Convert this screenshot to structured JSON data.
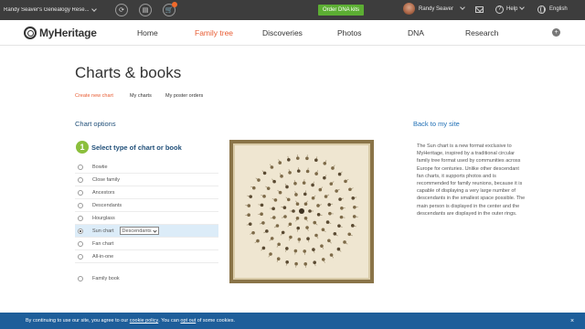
{
  "topbar": {
    "site_name": "Randy Seaver's Genealogy Rese...",
    "order_dna": "Order DNA kits",
    "user_name": "Randy Seaver",
    "help": "Help",
    "language": "English"
  },
  "nav": {
    "logo": "MyHeritage",
    "items": [
      {
        "label": "Home"
      },
      {
        "label": "Family tree"
      },
      {
        "label": "Discoveries"
      },
      {
        "label": "Photos"
      },
      {
        "label": "DNA"
      },
      {
        "label": "Research"
      }
    ],
    "active": "Family tree"
  },
  "page": {
    "title": "Charts & books",
    "subtabs": [
      {
        "label": "Create new chart"
      },
      {
        "label": "My charts"
      },
      {
        "label": "My poster orders"
      }
    ],
    "section_label": "Chart options",
    "back_link": "Back to my site",
    "step_number": "1",
    "step_title": "Select type of chart or book",
    "options": [
      {
        "label": "Bowtie"
      },
      {
        "label": "Close family"
      },
      {
        "label": "Ancestors"
      },
      {
        "label": "Descendants"
      },
      {
        "label": "Hourglass"
      },
      {
        "label": "Sun chart",
        "selected": true,
        "dropdown": "Descendants"
      },
      {
        "label": "Fan chart"
      },
      {
        "label": "All-in-one"
      },
      {
        "label": "Family book"
      }
    ],
    "description": "The Sun chart is a new format exclusive to MyHeritage, inspired by a traditional circular family tree format used by communities across Europe for centuries. Unlike other descendant fan charts, it supports photos and is recommended for family reunions, because it is capable of displaying a very large number of descendants in the smallest space possible. The main person is displayed in the center and the descendants are displayed in the outer rings."
  },
  "cookie": {
    "prefix": "By continuing to use our site, you agree to our ",
    "policy_link": "cookie policy",
    "middle": ". You can ",
    "opt_out_link": "opt out",
    "suffix": " of some cookies.",
    "close": "×"
  },
  "colors": {
    "topbar": "#3d3d3d",
    "accent": "#e85c33",
    "green": "#5cae33",
    "link": "#1f6fb5",
    "cookie_bar": "#1e5e9a"
  }
}
